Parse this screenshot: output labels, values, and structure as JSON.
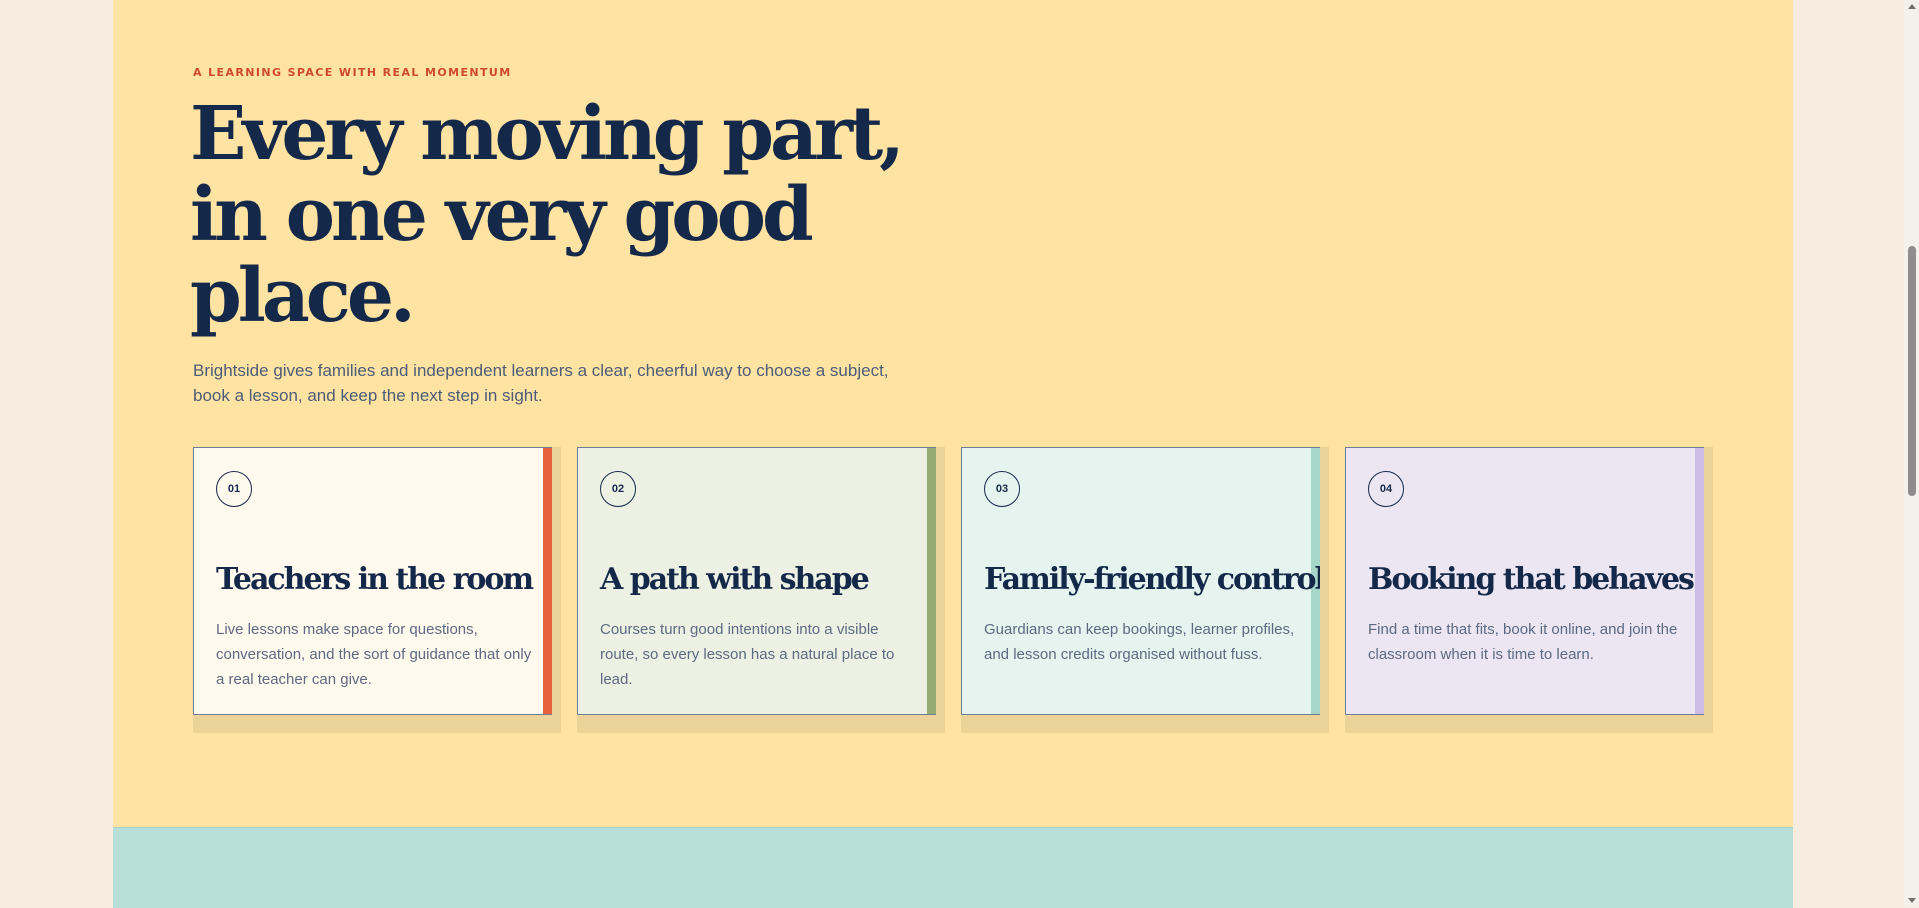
{
  "hero": {
    "eyebrow": "A LEARNING SPACE WITH REAL MOMENTUM",
    "headline_line1": "Every moving part,",
    "headline_line2": "in one very good",
    "headline_line3": "place.",
    "lede": "Brightside gives families and independent learners a clear, cheerful way to choose a subject, book a lesson, and keep the next step in sight."
  },
  "cards": [
    {
      "number": "01",
      "title": "Teachers in the room",
      "body": "Live lessons make space for questions, conversation, and the sort of guidance that only a real teacher can give.",
      "bg_color": "#fff9ee",
      "stripe_color": "#e8613f"
    },
    {
      "number": "02",
      "title": "A path with shape",
      "body": "Courses turn good intentions into a visible route, so every lesson has a natural place to lead.",
      "bg_color": "#edf1e4",
      "stripe_color": "#94ab72"
    },
    {
      "number": "03",
      "title": "Family-friendly control",
      "body": "Guardians can keep bookings, learner profiles, and lesson credits organised without fuss.",
      "bg_color": "#e5f4ef",
      "stripe_color": "#a6d6c7"
    },
    {
      "number": "04",
      "title": "Booking that behaves",
      "body": "Find a time that fits, book it online, and join the classroom when it is time to learn.",
      "bg_color": "#ece5f2",
      "stripe_color": "#cdbde6"
    }
  ],
  "colors": {
    "page_bg": "#f6ede0",
    "section_bg": "#ffe3a3",
    "accent": "#d0492f",
    "ink": "#14284a",
    "next_section_bg": "#b7ded7"
  }
}
